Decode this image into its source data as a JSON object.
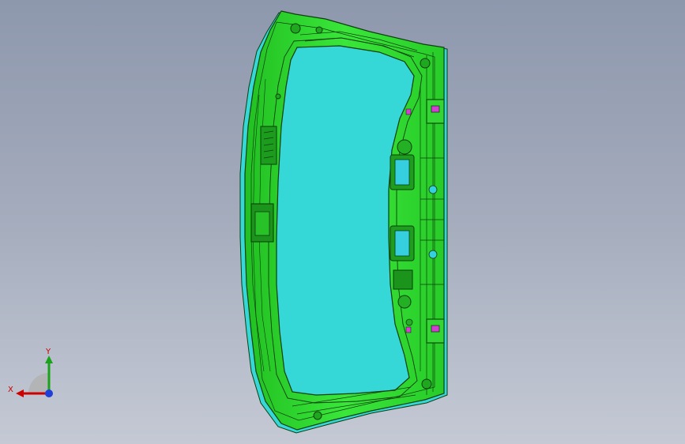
{
  "viewport": {
    "background_top": "#8e98ad",
    "background_bottom": "#c4c9d4"
  },
  "model": {
    "part_color": "#2ee02e",
    "edge_color": "#0f3d0f",
    "highlight_color": "#33d6d6",
    "marker_color": "#d43cd4"
  },
  "triad": {
    "x_label": "X",
    "y_label": "Y",
    "x_color": "#cc0000",
    "y_color": "#1aa31a",
    "z_color": "#1f3fd9"
  }
}
